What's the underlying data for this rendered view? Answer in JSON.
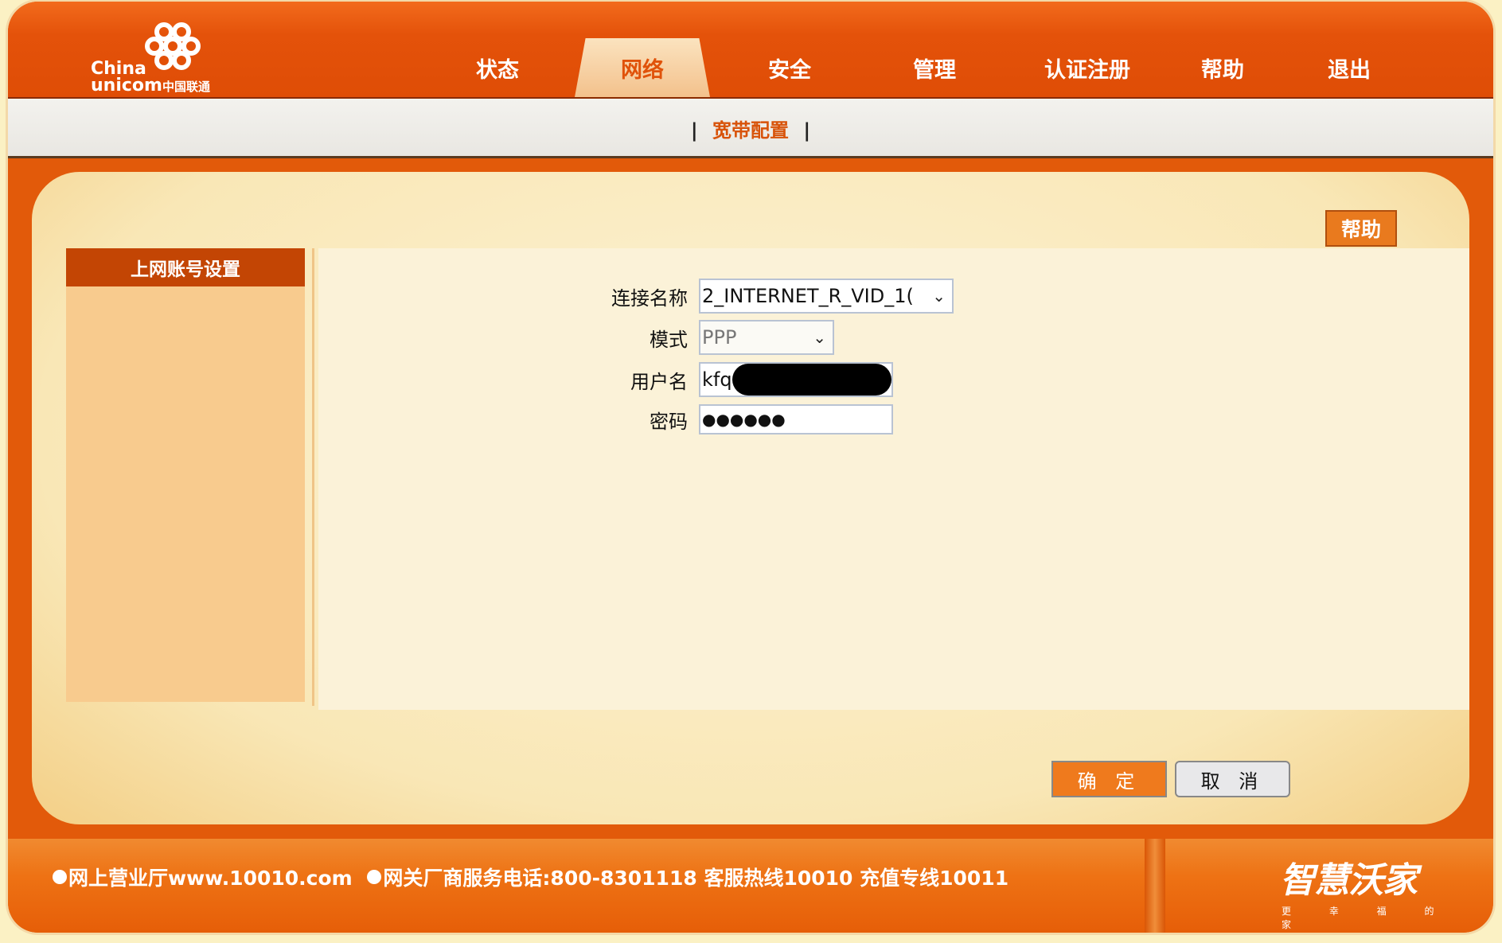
{
  "brand": {
    "logo_line1": "China",
    "logo_line2": "unicom",
    "logo_cn": "中国联通"
  },
  "nav": [
    {
      "label": "状态"
    },
    {
      "label": "网络"
    },
    {
      "label": "安全"
    },
    {
      "label": "管理"
    },
    {
      "label": "认证注册"
    },
    {
      "label": "帮助"
    },
    {
      "label": "退出"
    }
  ],
  "nav_active": "网络",
  "subnav": {
    "sep_left": "|",
    "link": "宽带配置",
    "sep_right": "|"
  },
  "help_button": "帮助",
  "sidebar": {
    "title": "上网账号设置"
  },
  "form": {
    "connection_name_label": "连接名称",
    "connection_name_value": "2_INTERNET_R_VID_1(",
    "mode_label": "模式",
    "mode_value": "PPP",
    "username_label": "用户名",
    "username_value": "kfq",
    "password_label": "密码",
    "password_value": "●●●●●●"
  },
  "buttons": {
    "ok": "确 定",
    "cancel": "取 消"
  },
  "footer": {
    "text1": "网上营业厅www.10010.com",
    "text2": "网关厂商服务电话:800-8301118 客服热线10010 充值专线10011",
    "brand": "智慧沃家",
    "brand_sub": "更 幸 福 的 家"
  },
  "colors": {
    "accent": "#e25a0a",
    "dark_accent": "#c34504",
    "panel": "#f8cb8e",
    "background": "#fbf2d8"
  }
}
